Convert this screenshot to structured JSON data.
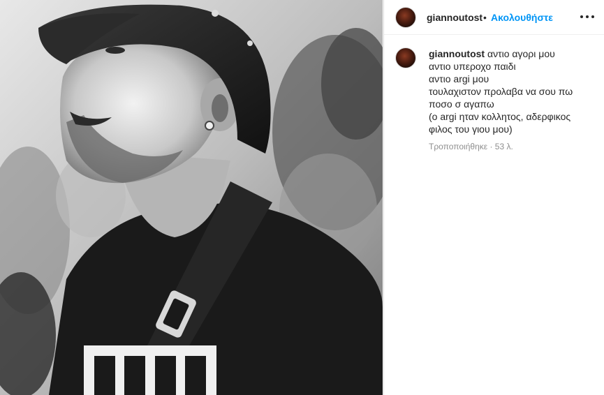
{
  "post": {
    "username": "giannoutost",
    "separator": "•",
    "follow_label": "Ακολουθήστε",
    "more_icon": "more-horizontal-icon",
    "photo_alt": "Ασπρόμαυρη φωτογραφία άνδρα με καπέλο"
  },
  "caption": {
    "username": "giannoutost",
    "first_line": "αντιο αγορι μου",
    "lines": [
      "αντιο υπεροχο παιδι",
      "αντιο argi μου",
      "τουλαχιστον προλαβα να σου πω",
      "ποσο σ αγαπω",
      "(ο argi ηταν κολλητος, αδερφικος",
      "φιλος του γιου μου)"
    ],
    "edited_label": "Τροποποιήθηκε",
    "dot": "·",
    "age": "53 λ."
  },
  "colors": {
    "link_blue": "#0095f6",
    "text": "#262626",
    "muted": "#8e8e8e",
    "border": "#dbdbdb"
  }
}
